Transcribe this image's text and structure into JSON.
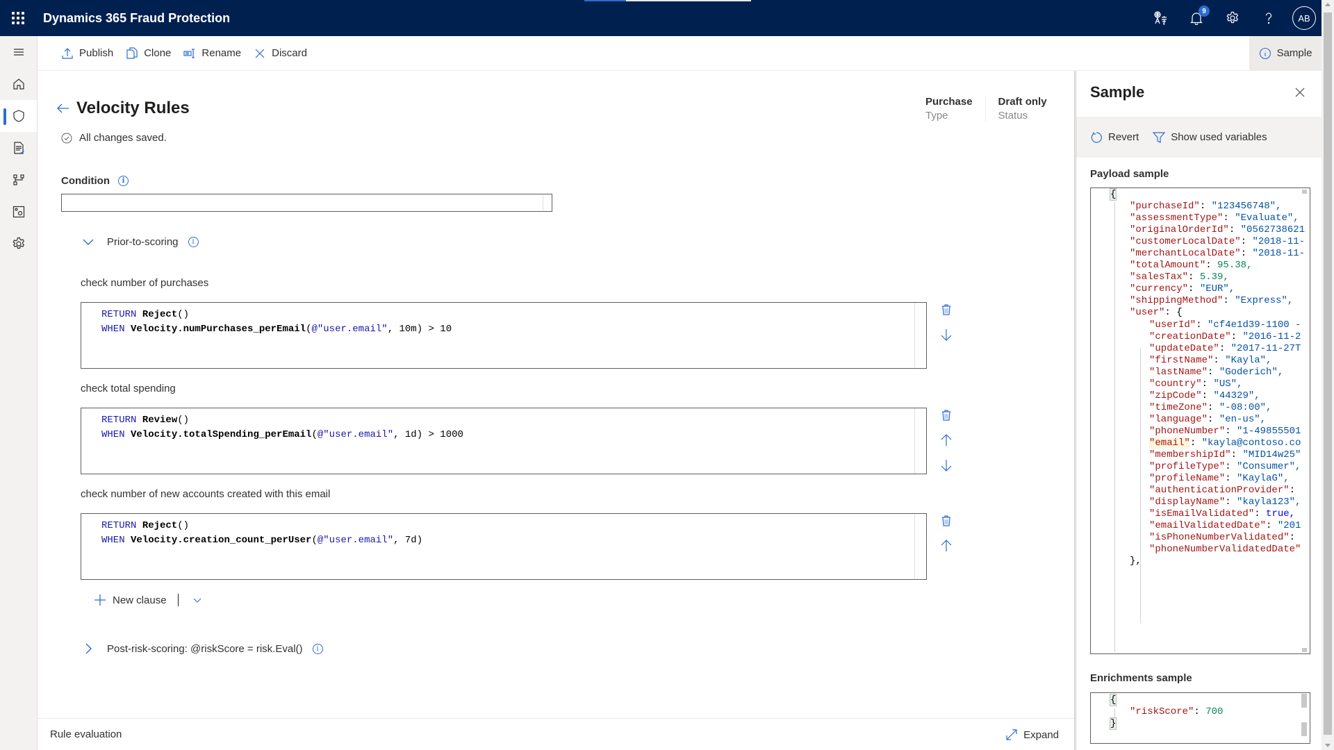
{
  "app": {
    "title": "Dynamics 365 Fraud Protection",
    "loading_progress_fraction": 0.25,
    "notifications_count": "9",
    "avatar_initials": "AB",
    "top_icons": [
      "translate-icon",
      "bell-icon",
      "gear-icon",
      "help-icon"
    ]
  },
  "nav": {
    "items": [
      {
        "icon": "hamburger-icon",
        "label": "Menu"
      },
      {
        "icon": "home-icon",
        "label": "Home"
      },
      {
        "icon": "shield-icon",
        "label": "Protection",
        "active": true
      },
      {
        "icon": "report-icon",
        "label": "Reports"
      },
      {
        "icon": "workflow-icon",
        "label": "Routing"
      },
      {
        "icon": "settings-panel-icon",
        "label": "Data"
      },
      {
        "icon": "settings-icon",
        "label": "Settings"
      }
    ]
  },
  "toolbar": {
    "publish": "Publish",
    "clone": "Clone",
    "rename": "Rename",
    "discard": "Discard",
    "sample": "Sample"
  },
  "page": {
    "title": "Velocity Rules",
    "saved_status": "All changes saved.",
    "type_value": "Purchase",
    "type_label": "Type",
    "status_value": "Draft only",
    "status_label": "Status",
    "condition_label": "Condition",
    "condition_value": ""
  },
  "prior_section": {
    "label": "Prior-to-scoring",
    "expanded": true
  },
  "clauses": [
    {
      "title": "check number of purchases",
      "line1_kw": "RETURN",
      "line1_fn": "Reject",
      "line1_rest": "()",
      "line2_kw": "WHEN",
      "line2_fn": "Velocity.numPurchases_perEmail",
      "line2_open": "(",
      "line2_str": "@\"user.email\"",
      "line2_rest": ", 10m) > 10",
      "actions": [
        "delete",
        "move-down"
      ]
    },
    {
      "title": "check total spending",
      "line1_kw": "RETURN",
      "line1_fn": "Review",
      "line1_rest": "()",
      "line2_kw": "WHEN",
      "line2_fn": "Velocity.totalSpending_perEmail",
      "line2_open": "(",
      "line2_str": "@\"user.email\"",
      "line2_rest": ", 1d) > 1000",
      "actions": [
        "delete",
        "move-up",
        "move-down"
      ]
    },
    {
      "title": "check number of new accounts created with this email",
      "line1_kw": "RETURN",
      "line1_fn": "Reject",
      "line1_rest": "()",
      "line2_kw": "WHEN",
      "line2_fn": "Velocity.creation_count_perUser",
      "line2_open": "(",
      "line2_str": "@\"user.email\"",
      "line2_rest": ", 7d)",
      "actions": [
        "delete",
        "move-up"
      ]
    }
  ],
  "new_clause_label": "New clause",
  "post_section": {
    "label": "Post-risk-scoring: @riskScore = risk.Eval()",
    "expanded": false
  },
  "rule_evaluation": {
    "label": "Rule evaluation",
    "expand_label": "Expand"
  },
  "sample_panel": {
    "title": "Sample",
    "revert": "Revert",
    "show_used_variables": "Show used variables",
    "payload_label": "Payload sample",
    "payload_lines": [
      {
        "indent": 0,
        "key": "",
        "val": "{",
        "type": "brace"
      },
      {
        "indent": 1,
        "key": "\"purchaseId\"",
        "val": "\"123456748\",",
        "type": "str"
      },
      {
        "indent": 1,
        "key": "\"assessmentType\"",
        "val": "\"Evaluate\",",
        "type": "str"
      },
      {
        "indent": 1,
        "key": "\"originalOrderId\"",
        "val": "\"0562738621",
        "type": "str"
      },
      {
        "indent": 1,
        "key": "\"customerLocalDate\"",
        "val": "\"2018-11-",
        "type": "str"
      },
      {
        "indent": 1,
        "key": "\"merchantLocalDate\"",
        "val": "\"2018-11-",
        "type": "str"
      },
      {
        "indent": 1,
        "key": "\"totalAmount\"",
        "val": "95.38,",
        "type": "num"
      },
      {
        "indent": 1,
        "key": "\"salesTax\"",
        "val": "5.39,",
        "type": "num"
      },
      {
        "indent": 1,
        "key": "\"currency\"",
        "val": "\"EUR\",",
        "type": "str"
      },
      {
        "indent": 1,
        "key": "\"shippingMethod\"",
        "val": "\"Express\",",
        "type": "str"
      },
      {
        "indent": 1,
        "key": "\"user\"",
        "val": "{",
        "type": "punct"
      },
      {
        "indent": 2,
        "key": "\"userId\"",
        "val": "\"cf4e1d39-1100 -",
        "type": "str"
      },
      {
        "indent": 2,
        "key": "\"creationDate\"",
        "val": "\"2016-11-2",
        "type": "str"
      },
      {
        "indent": 2,
        "key": "\"updateDate\"",
        "val": "\"2017-11-27T",
        "type": "str"
      },
      {
        "indent": 2,
        "key": "\"firstName\"",
        "val": "\"Kayla\",",
        "type": "str"
      },
      {
        "indent": 2,
        "key": "\"lastName\"",
        "val": "\"Goderich\",",
        "type": "str"
      },
      {
        "indent": 2,
        "key": "\"country\"",
        "val": "\"US\",",
        "type": "str"
      },
      {
        "indent": 2,
        "key": "\"zipCode\"",
        "val": "\"44329\",",
        "type": "str"
      },
      {
        "indent": 2,
        "key": "\"timeZone\"",
        "val": "\"-08:00\",",
        "type": "str"
      },
      {
        "indent": 2,
        "key": "\"language\"",
        "val": "\"en-us\",",
        "type": "str"
      },
      {
        "indent": 2,
        "key": "\"phoneNumber\"",
        "val": "\"1-49855501",
        "type": "str"
      },
      {
        "indent": 2,
        "key": "\"email\"",
        "val": "\"kayla@contoso.co",
        "type": "str",
        "highlight": true
      },
      {
        "indent": 2,
        "key": "\"membershipId\"",
        "val": "\"MID14w25\"",
        "type": "str"
      },
      {
        "indent": 2,
        "key": "\"profileType\"",
        "val": "\"Consumer\",",
        "type": "str"
      },
      {
        "indent": 2,
        "key": "\"profileName\"",
        "val": "\"KaylaG\",",
        "type": "str"
      },
      {
        "indent": 2,
        "key": "\"authenticationProvider\"",
        "val": "",
        "type": "str"
      },
      {
        "indent": 2,
        "key": "\"displayName\"",
        "val": "\"kayla123\",",
        "type": "str"
      },
      {
        "indent": 2,
        "key": "\"isEmailValidated\"",
        "val": "true,",
        "type": "bool"
      },
      {
        "indent": 2,
        "key": "\"emailValidatedDate\"",
        "val": "\"201",
        "type": "str"
      },
      {
        "indent": 2,
        "key": "\"isPhoneNumberValidated\"",
        "val": "",
        "type": "str"
      },
      {
        "indent": 2,
        "key": "\"phoneNumberValidatedDate\"",
        "val": "",
        "type": "str",
        "nocolon": true
      },
      {
        "indent": 1,
        "key": "",
        "val": "},",
        "type": "punct"
      }
    ],
    "enrichments_label": "Enrichments sample",
    "enrichment_lines": [
      {
        "indent": 0,
        "key": "",
        "val": "{",
        "type": "brace"
      },
      {
        "indent": 1,
        "key": "\"riskScore\"",
        "val": "700",
        "type": "num"
      },
      {
        "indent": 0,
        "key": "",
        "val": "}",
        "type": "brace"
      }
    ]
  },
  "colors": {
    "topbar": "#002050",
    "accent": "#2b6dd0"
  }
}
